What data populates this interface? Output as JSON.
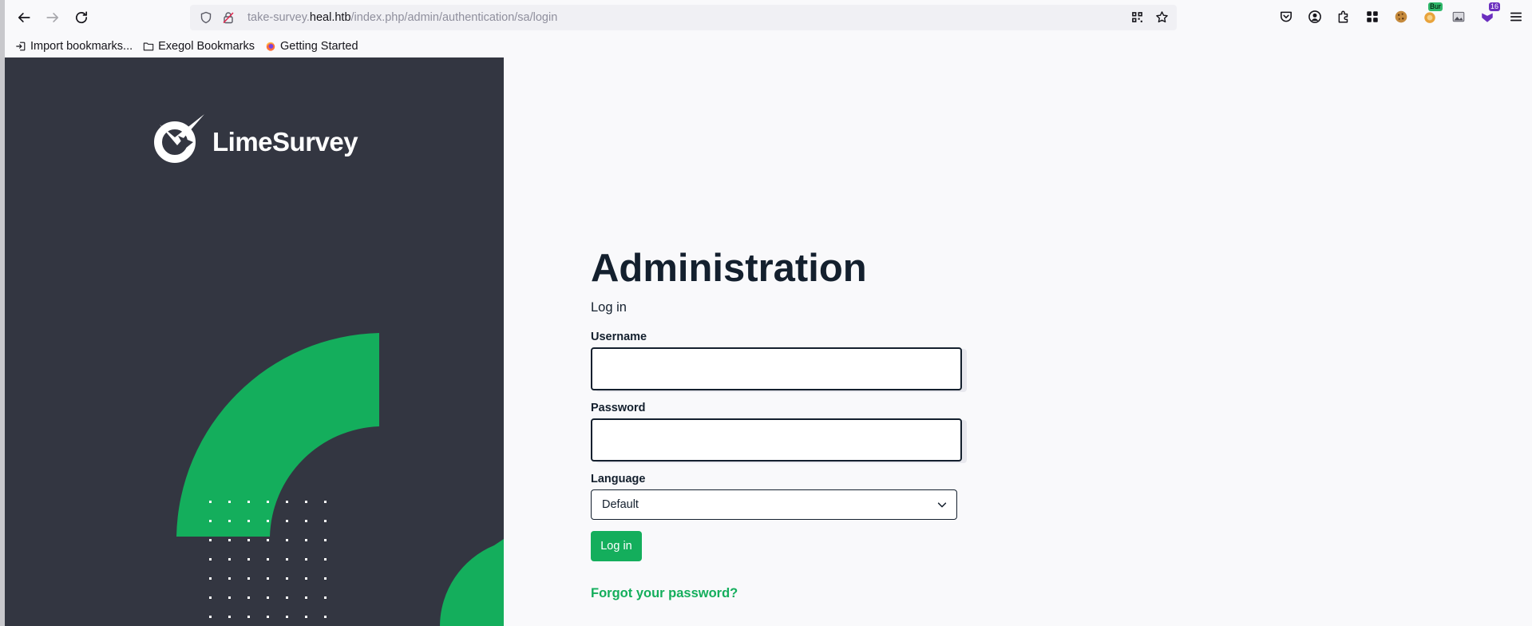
{
  "browser": {
    "url_prefix": "take-survey.",
    "url_domain": "heal.htb",
    "url_path": "/index.php/admin/authentication/sa/login",
    "extension_badge_1": "Bur",
    "extension_badge_2": "16"
  },
  "bookmarks": [
    {
      "label": "Import bookmarks...",
      "icon": "import-icon"
    },
    {
      "label": "Exegol Bookmarks",
      "icon": "folder-icon"
    },
    {
      "label": "Getting Started",
      "icon": "firefox-icon"
    }
  ],
  "brand": {
    "name": "LimeSurvey",
    "accent": "#14ae5c",
    "panel_color": "#333641"
  },
  "login": {
    "title": "Administration",
    "subtitle": "Log in",
    "username_label": "Username",
    "username_value": "",
    "password_label": "Password",
    "password_value": "",
    "language_label": "Language",
    "language_value": "Default",
    "submit_label": "Log in",
    "forgot_label": "Forgot your password?"
  }
}
